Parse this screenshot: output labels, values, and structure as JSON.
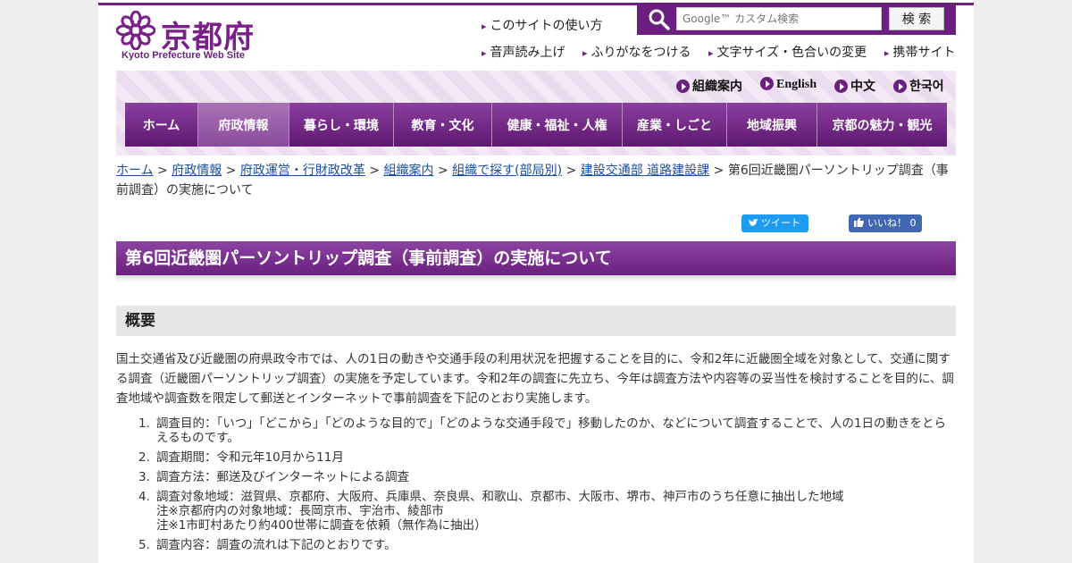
{
  "header": {
    "logo_text": "京都府",
    "logo_sub": "Kyoto Prefecture Web Site",
    "search": {
      "placeholder": "Google™ カスタム検索",
      "button": "検 索"
    },
    "utility_links": [
      "このサイトの使い方",
      "音声読み上げ",
      "ふりがなをつける",
      "文字サイズ・色合いの変更",
      "携帯サイト"
    ],
    "lang_links": [
      "組織案内",
      "English",
      "中文",
      "한국어"
    ]
  },
  "global_nav": [
    {
      "label": "ホーム"
    },
    {
      "label": "府政情報",
      "active": true
    },
    {
      "label": "暮らし・環境"
    },
    {
      "label": "教育・文化"
    },
    {
      "label": "健康・福祉・人権"
    },
    {
      "label": "産業・しごと"
    },
    {
      "label": "地域振興"
    },
    {
      "label": "京都の魅力・観光"
    }
  ],
  "breadcrumb": {
    "links": [
      "ホーム",
      "府政情報",
      "府政運営・行財政改革",
      "組織案内",
      "組織で探す(部局別)",
      "建設交通部 道路建設課"
    ],
    "current": "第6回近畿圏パーソントリップ調査（事前調査）の実施について"
  },
  "social": {
    "tweet": "ツイート",
    "like": "いいね！ 0"
  },
  "page_title": "第6回近畿圏パーソントリップ調査（事前調査）の実施について",
  "section_heading": "概要",
  "intro": "国土交通省及び近畿圏の府県政令市では、人の1日の動きや交通手段の利用状況を把握することを目的に、令和2年に近畿圏全域を対象として、交通に関する調査（近畿圏パーソントリップ調査）の実施を予定しています。令和2年の調査に先立ち、今年は調査方法や内容等の妥当性を検討することを目的に、調査地域や調査数を限定して郵送とインターネットで事前調査を下記のとおり実施します。",
  "items": [
    {
      "num": "1.",
      "lines": [
        "調査目的：「いつ」「どこから」「どのような目的で」「どのような交通手段で」移動したのか、などについて調査することで、人の1日の動きをとらえるものです。"
      ]
    },
    {
      "num": "2.",
      "lines": [
        "調査期間：令和元年10月から11月"
      ]
    },
    {
      "num": "3.",
      "lines": [
        "調査方法：郵送及びインターネットによる調査"
      ]
    },
    {
      "num": "4.",
      "lines": [
        "調査対象地域：滋賀県、京都府、大阪府、兵庫県、奈良県、和歌山、京都市、大阪市、堺市、神戸市のうち任意に抽出した地域",
        "注※京都府内の対象地域：長岡京市、宇治市、綾部市",
        "注※1市町村あたり約400世帯に調査を依頼（無作為に抽出）"
      ]
    },
    {
      "num": "5.",
      "lines": [
        "調査内容：調査の流れは下記のとおりです。"
      ]
    }
  ]
}
